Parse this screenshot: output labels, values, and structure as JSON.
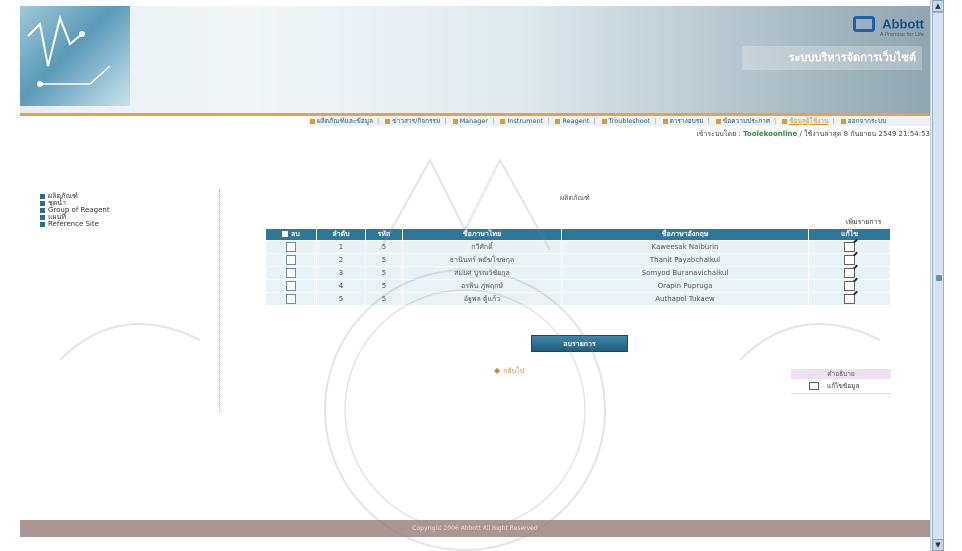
{
  "brand": {
    "name": "Abbott",
    "tagline": "A Promise for Life"
  },
  "site_title": "ระบบบริหารจัดการเว็บไซต์",
  "nav": {
    "items": [
      "ผลิตภัณฑ์และข้อมูล",
      "ข่าวสาร/กิจกรรม",
      "Manager",
      "Instrument",
      "Reagent",
      "Troubleshoot",
      "ตารางอบรม",
      "ข้อความประกาศ",
      "ข้อมูลผู้ใช้งาน",
      "ออกจากระบบ"
    ],
    "active_index": 8
  },
  "welcome": {
    "label": "เข้าระบบโดย :",
    "username": "Toolekoonline",
    "detail": "/ ใช้งานล่าสุด 8 กันยายน 2549 21:54:53"
  },
  "sidebar": {
    "items": [
      "ผลิตภัณฑ์",
      "ชุดน้ำ",
      "Group of Reagent",
      "แผนที่",
      "Reference Site"
    ]
  },
  "main": {
    "title": "ผลิตภัณฑ์",
    "add_link": "เพิ่มรายการ",
    "columns": [
      "ลบ",
      "ลำดับ",
      "รหัส",
      "ชื่อภาษาไทย",
      "ชื่อภาษาอังกฤษ",
      "แก้ไข"
    ],
    "rows": [
      {
        "no": "1",
        "code": "5",
        "th": "กวีศักดิ์",
        "en": "Kaweesak Naiburin"
      },
      {
        "no": "2",
        "code": "5",
        "th": "ธานินทร์ พยัฆโฆษกุล",
        "en": "Thanit Payabchaikul"
      },
      {
        "no": "3",
        "code": "5",
        "th": "สมยศ บูรณวิชัยกุล",
        "en": "Somyod Buranavichaikul"
      },
      {
        "no": "4",
        "code": "5",
        "th": "อรพิน ภู่พฤกษ์",
        "en": "Orapin Pupruga"
      },
      {
        "no": "5",
        "code": "5",
        "th": "อัฐพล ตู้แก้ว",
        "en": "Authapol Tukaew"
      }
    ],
    "delete_button": "ลบรายการ",
    "back_link": "กลับไป"
  },
  "legend": {
    "header": "คำอธิบาย",
    "item": "แก้ไขข้อมูล"
  },
  "footer": "Copyright  2006  Abbott  All Right Reserved",
  "colors": {
    "table_header": "#2d7898",
    "row_bg": "#e9f2f6",
    "accent": "#e59a2e",
    "footer_bg": "#aa9692"
  }
}
